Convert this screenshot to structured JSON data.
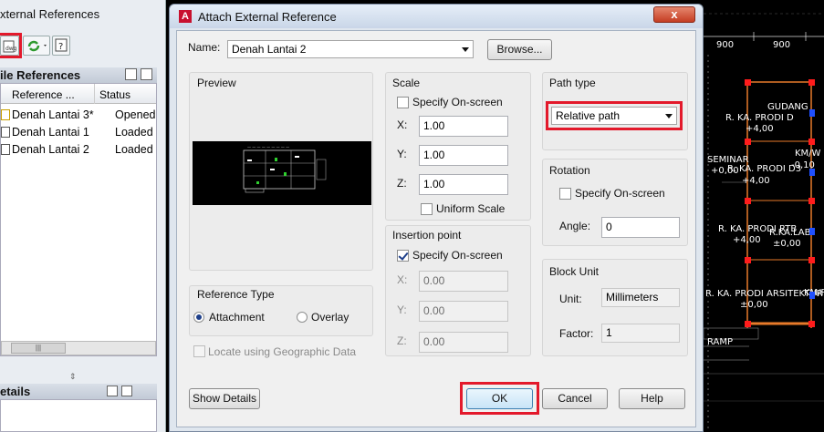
{
  "palette": {
    "title": "xternal References",
    "file_refs_header": "ile References",
    "columns": [
      "Reference ...",
      "Status"
    ],
    "rows": [
      {
        "name": "Denah Lantai 3*",
        "status": "Opened"
      },
      {
        "name": "Denah Lantai 1",
        "status": "Loaded"
      },
      {
        "name": "Denah Lantai 2",
        "status": "Loaded"
      }
    ],
    "details_header": "etails",
    "scroll_grip": "|||"
  },
  "dialog": {
    "title": "Attach External Reference",
    "icon_letter": "A",
    "close": "x",
    "name_label": "Name:",
    "name_value": "Denah Lantai 2",
    "browse": "Browse...",
    "preview_label": "Preview",
    "scale": {
      "title": "Scale",
      "specify": "Specify On-screen",
      "specify_checked": false,
      "x_label": "X:",
      "x": "1.00",
      "y_label": "Y:",
      "y": "1.00",
      "z_label": "Z:",
      "z": "1.00",
      "uniform": "Uniform Scale",
      "uniform_checked": false
    },
    "insertion": {
      "title": "Insertion point",
      "specify": "Specify On-screen",
      "specify_checked": true,
      "x_label": "X:",
      "x": "0.00",
      "y_label": "Y:",
      "y": "0.00",
      "z_label": "Z:",
      "z": "0.00"
    },
    "path_type": {
      "title": "Path type",
      "value": "Relative path"
    },
    "rotation": {
      "title": "Rotation",
      "specify": "Specify On-screen",
      "specify_checked": false,
      "angle_label": "Angle:",
      "angle": "0"
    },
    "block_unit": {
      "title": "Block Unit",
      "unit_label": "Unit:",
      "unit": "Millimeters",
      "factor_label": "Factor:",
      "factor": "1"
    },
    "reference_type": {
      "title": "Reference Type",
      "attachment": "Attachment",
      "overlay": "Overlay",
      "selected": "attachment"
    },
    "geo": "Locate using Geographic Data",
    "buttons": {
      "show_details": "Show Details",
      "ok": "OK",
      "cancel": "Cancel",
      "help": "Help"
    }
  },
  "drawing": {
    "dims": [
      "900",
      "900"
    ],
    "labels": [
      "GUDANG",
      "R. KA. PRODI D",
      "+4,00",
      "SEMINAR",
      "+0,00",
      "R. KA. PRODI D3",
      "+4,00",
      "KM/W",
      "-0,10",
      "R. KA. PRODI RTB",
      "+4,00",
      "R.KA.LAB",
      "±0,00",
      "R. KA. PRODI ARSITEKTUR",
      "±0,00",
      "KM/P",
      "RAMP"
    ]
  },
  "colors": {
    "highlight_red": "#e3192b",
    "dialog_bg": "#f0f0f0",
    "titlebar": "#c9d6e8",
    "close_red": "#c43d22",
    "grip_red": "#ff1c1c",
    "grip_blue": "#2050ff"
  },
  "icons": [
    "attach-dwg-icon",
    "refresh-icon",
    "help-icon",
    "list-view-icon",
    "tree-view-icon",
    "autocad-app-icon",
    "file-icon"
  ]
}
